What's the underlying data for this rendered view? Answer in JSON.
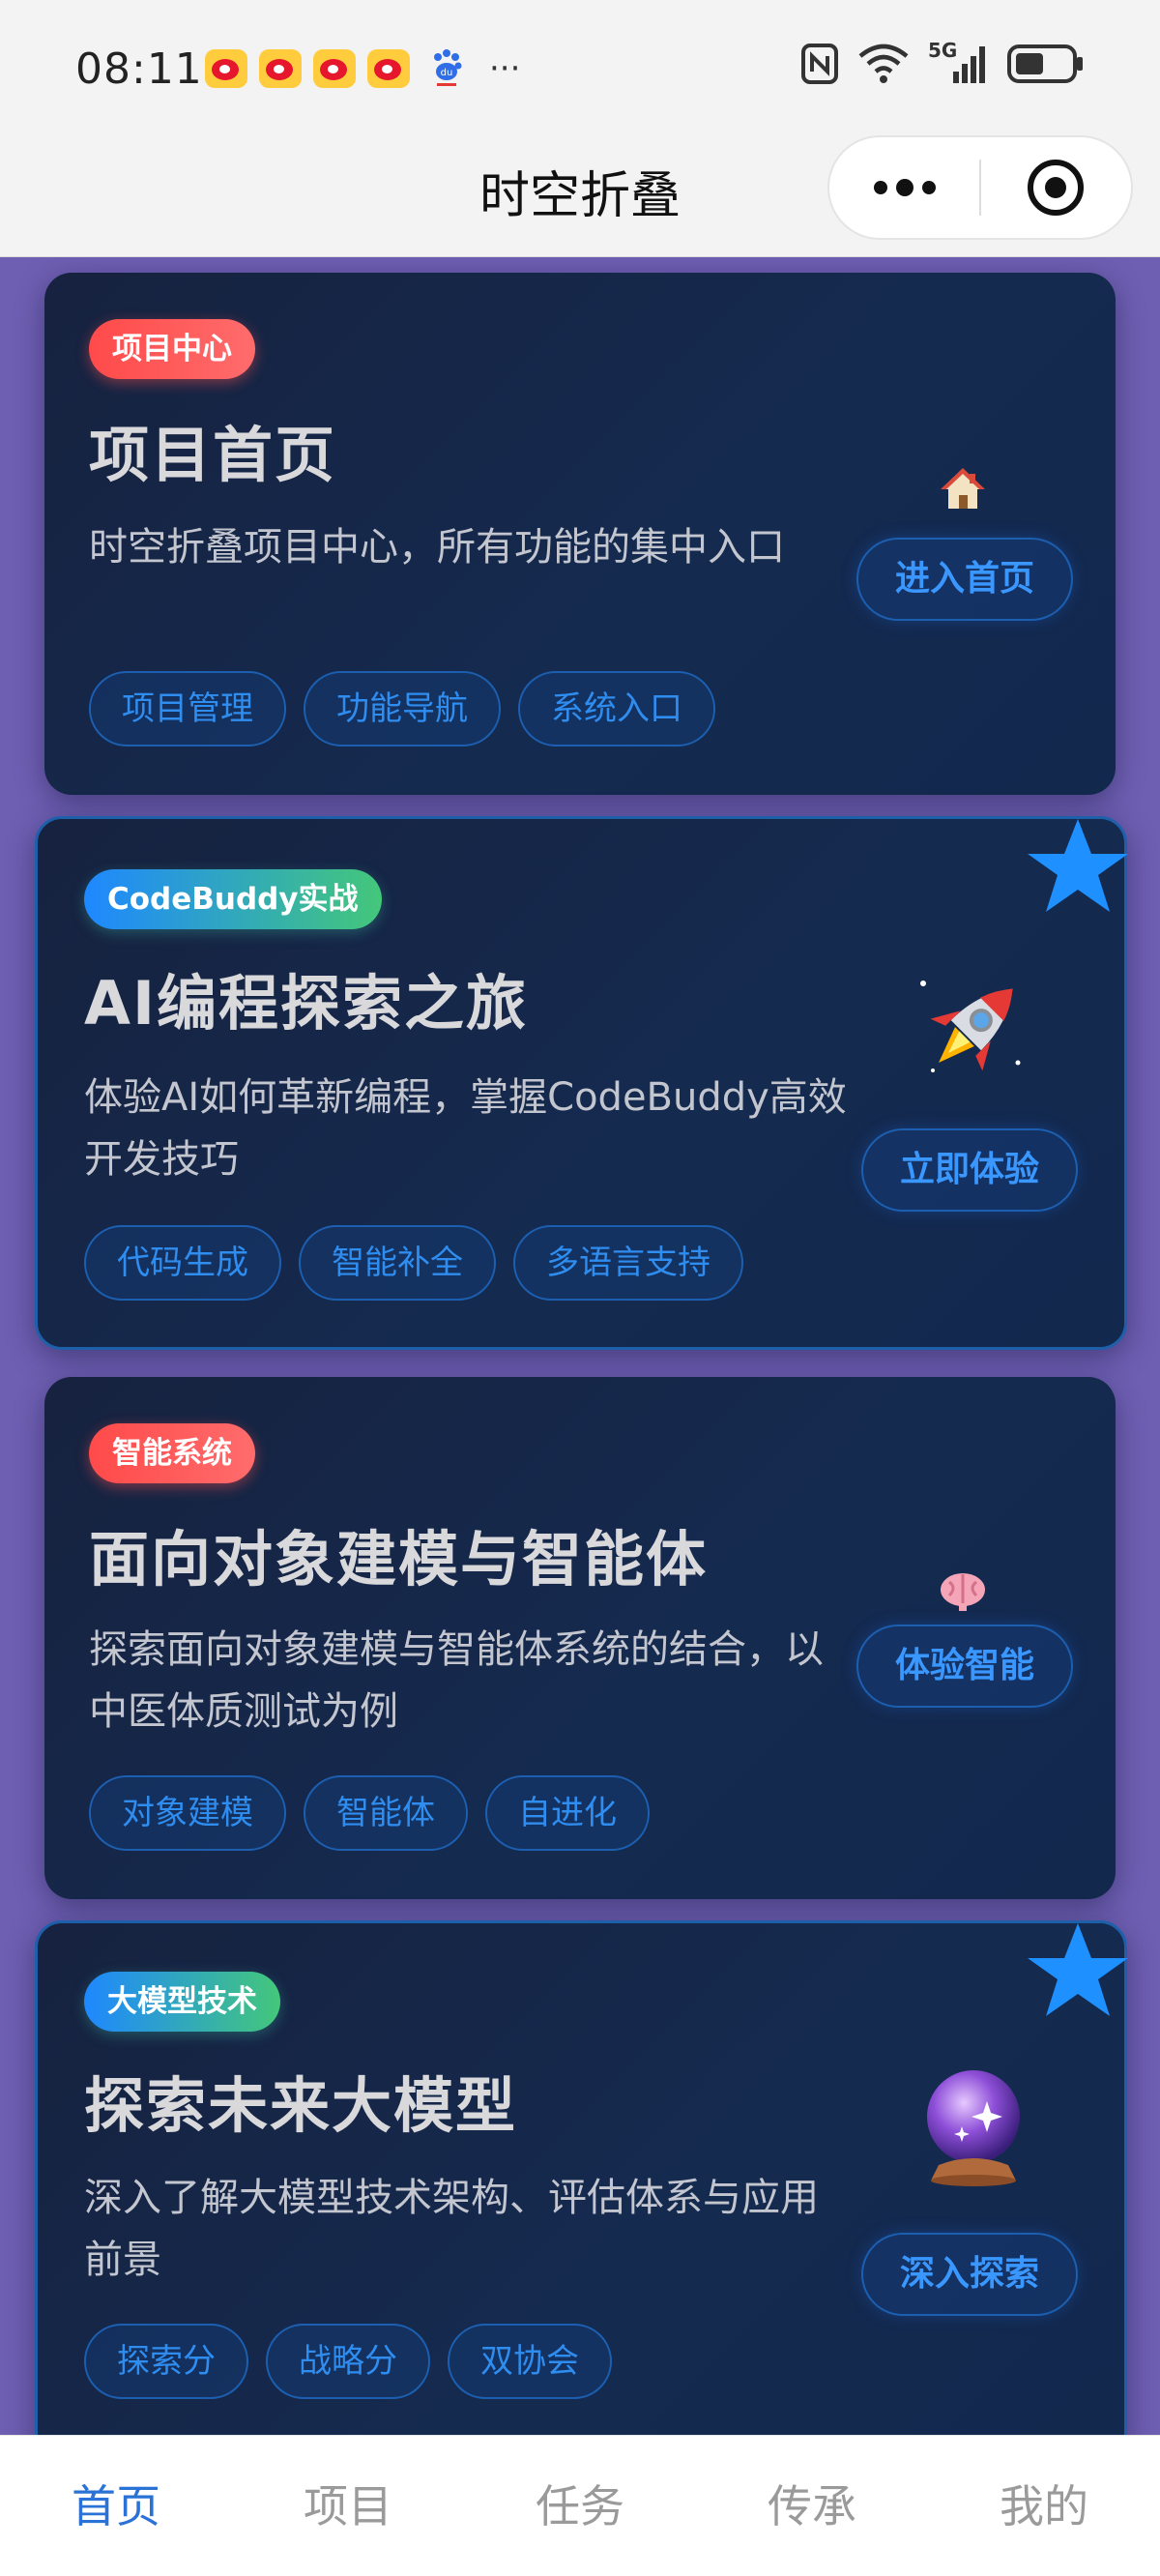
{
  "status_bar": {
    "time": "08:11",
    "more": "···",
    "network_label": "5G",
    "app_icons": [
      "weibo-icon",
      "weibo-icon",
      "weibo-icon",
      "weibo-icon",
      "baidu-icon"
    ]
  },
  "header": {
    "title": "时空折叠"
  },
  "cards": [
    {
      "tag": "项目中心",
      "title": "项目首页",
      "description": "时空折叠项目中心，所有功能的集中入口",
      "chips": [
        "项目管理",
        "功能导航",
        "系统入口"
      ],
      "cta": "进入首页",
      "icon": "house-icon",
      "featured": false
    },
    {
      "tag": "CodeBuddy实战",
      "title": "AI编程探索之旅",
      "description": "体验AI如何革新编程，掌握CodeBuddy高效开发技巧",
      "chips": [
        "代码生成",
        "智能补全",
        "多语言支持"
      ],
      "cta": "立即体验",
      "icon": "rocket-icon",
      "featured": true
    },
    {
      "tag": "智能系统",
      "title": "面向对象建模与智能体",
      "description": "探索面向对象建模与智能体系统的结合，以中医体质测试为例",
      "chips": [
        "对象建模",
        "智能体",
        "自进化"
      ],
      "cta": "体验智能",
      "icon": "brain-icon",
      "featured": false
    },
    {
      "tag": "大模型技术",
      "title": "探索未来大模型",
      "description": "深入了解大模型技术架构、评估体系与应用前景",
      "chips": [
        "探索分",
        "战略分",
        "双协会"
      ],
      "cta": "深入探索",
      "icon": "crystal-ball-icon",
      "featured": true
    }
  ],
  "tabbar": {
    "tabs": [
      "首页",
      "项目",
      "任务",
      "传承",
      "我的"
    ],
    "active": "首页"
  },
  "colors": {
    "page_background": "#6f5fb3",
    "card_background": "#152a4f",
    "accent_blue": "#2f8df0",
    "tag_red": "#ff4a4a",
    "star_blue": "#1e90ff",
    "tab_active": "#2a72d6"
  }
}
